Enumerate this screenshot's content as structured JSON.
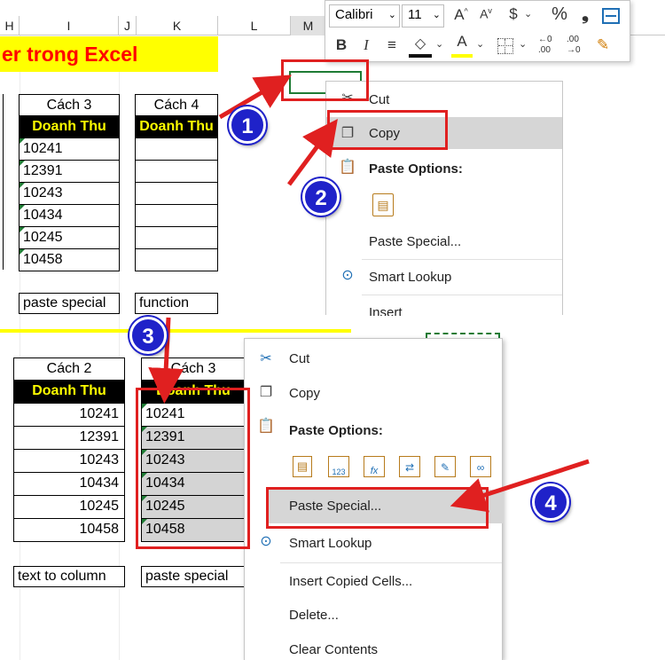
{
  "columns": [
    "H",
    "I",
    "J",
    "K",
    "L",
    "M"
  ],
  "title_text": "er trong Excel",
  "top": {
    "cach3_header": "Cách 3",
    "cach4_header": "Cách 4",
    "doanh_thu": "Doanh Thu",
    "values": [
      "10241",
      "12391",
      "10243",
      "10434",
      "10245",
      "10458"
    ],
    "label_paste": "paste special",
    "label_function": "function"
  },
  "bottom": {
    "cach2_header": "Cách 2",
    "cach3_header": "Cách 3",
    "doanh_thu": "Doanh Thu",
    "values_right": [
      "10241",
      "12391",
      "10243",
      "10434",
      "10245",
      "10458"
    ],
    "values_left": [
      "10241",
      "12391",
      "10243",
      "10434",
      "10245",
      "10458"
    ],
    "label_text_to_column": "text to column",
    "label_paste": "paste special"
  },
  "mini_toolbar": {
    "font_name": "Calibri",
    "font_size": "11",
    "grow": "A",
    "shrink": "A",
    "currency": "$",
    "percent": "%",
    "comma": "❟",
    "bold": "B",
    "italic": "I",
    "font_color": "A",
    "dec_inc_top": "←0",
    "dec_inc_bot": ".00",
    "dec_dec_top": ".00",
    "dec_dec_bot": "→0"
  },
  "menu1": {
    "cut": "Cut",
    "copy": "Copy",
    "paste_options": "Paste Options:",
    "paste_special": "Paste Special...",
    "smart_lookup": "Smart Lookup",
    "insert": "Insert"
  },
  "menu2": {
    "cut": "Cut",
    "copy": "Copy",
    "paste_options": "Paste Options:",
    "paste_icon_labels": [
      "123",
      "fx"
    ],
    "paste_special": "Paste Special...",
    "smart_lookup": "Smart Lookup",
    "insert_copied": "Insert Copied Cells...",
    "delete": "Delete...",
    "clear": "Clear Contents"
  },
  "badges": [
    "1",
    "2",
    "3",
    "4"
  ],
  "colors": {
    "accent_red": "#e02020",
    "badge_blue": "#1f22c9",
    "header_yellow": "#ffff00",
    "title_red": "#ff0000"
  }
}
